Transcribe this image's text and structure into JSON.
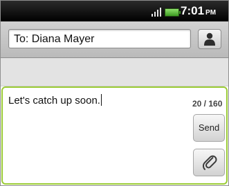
{
  "status_bar": {
    "time": "7:01",
    "ampm": "PM",
    "icons": [
      "signal-icon",
      "battery-icon"
    ]
  },
  "recipient": {
    "value": "To: Diana Mayer",
    "contact_icon": "person-icon"
  },
  "composer": {
    "message": "Let's catch up soon.",
    "char_count": "20 / 160",
    "send_label": "Send",
    "attach_icon": "paperclip-icon"
  },
  "colors": {
    "accent_border": "#9acb34",
    "status_bar": "#000000",
    "battery": "#3d9b22"
  }
}
